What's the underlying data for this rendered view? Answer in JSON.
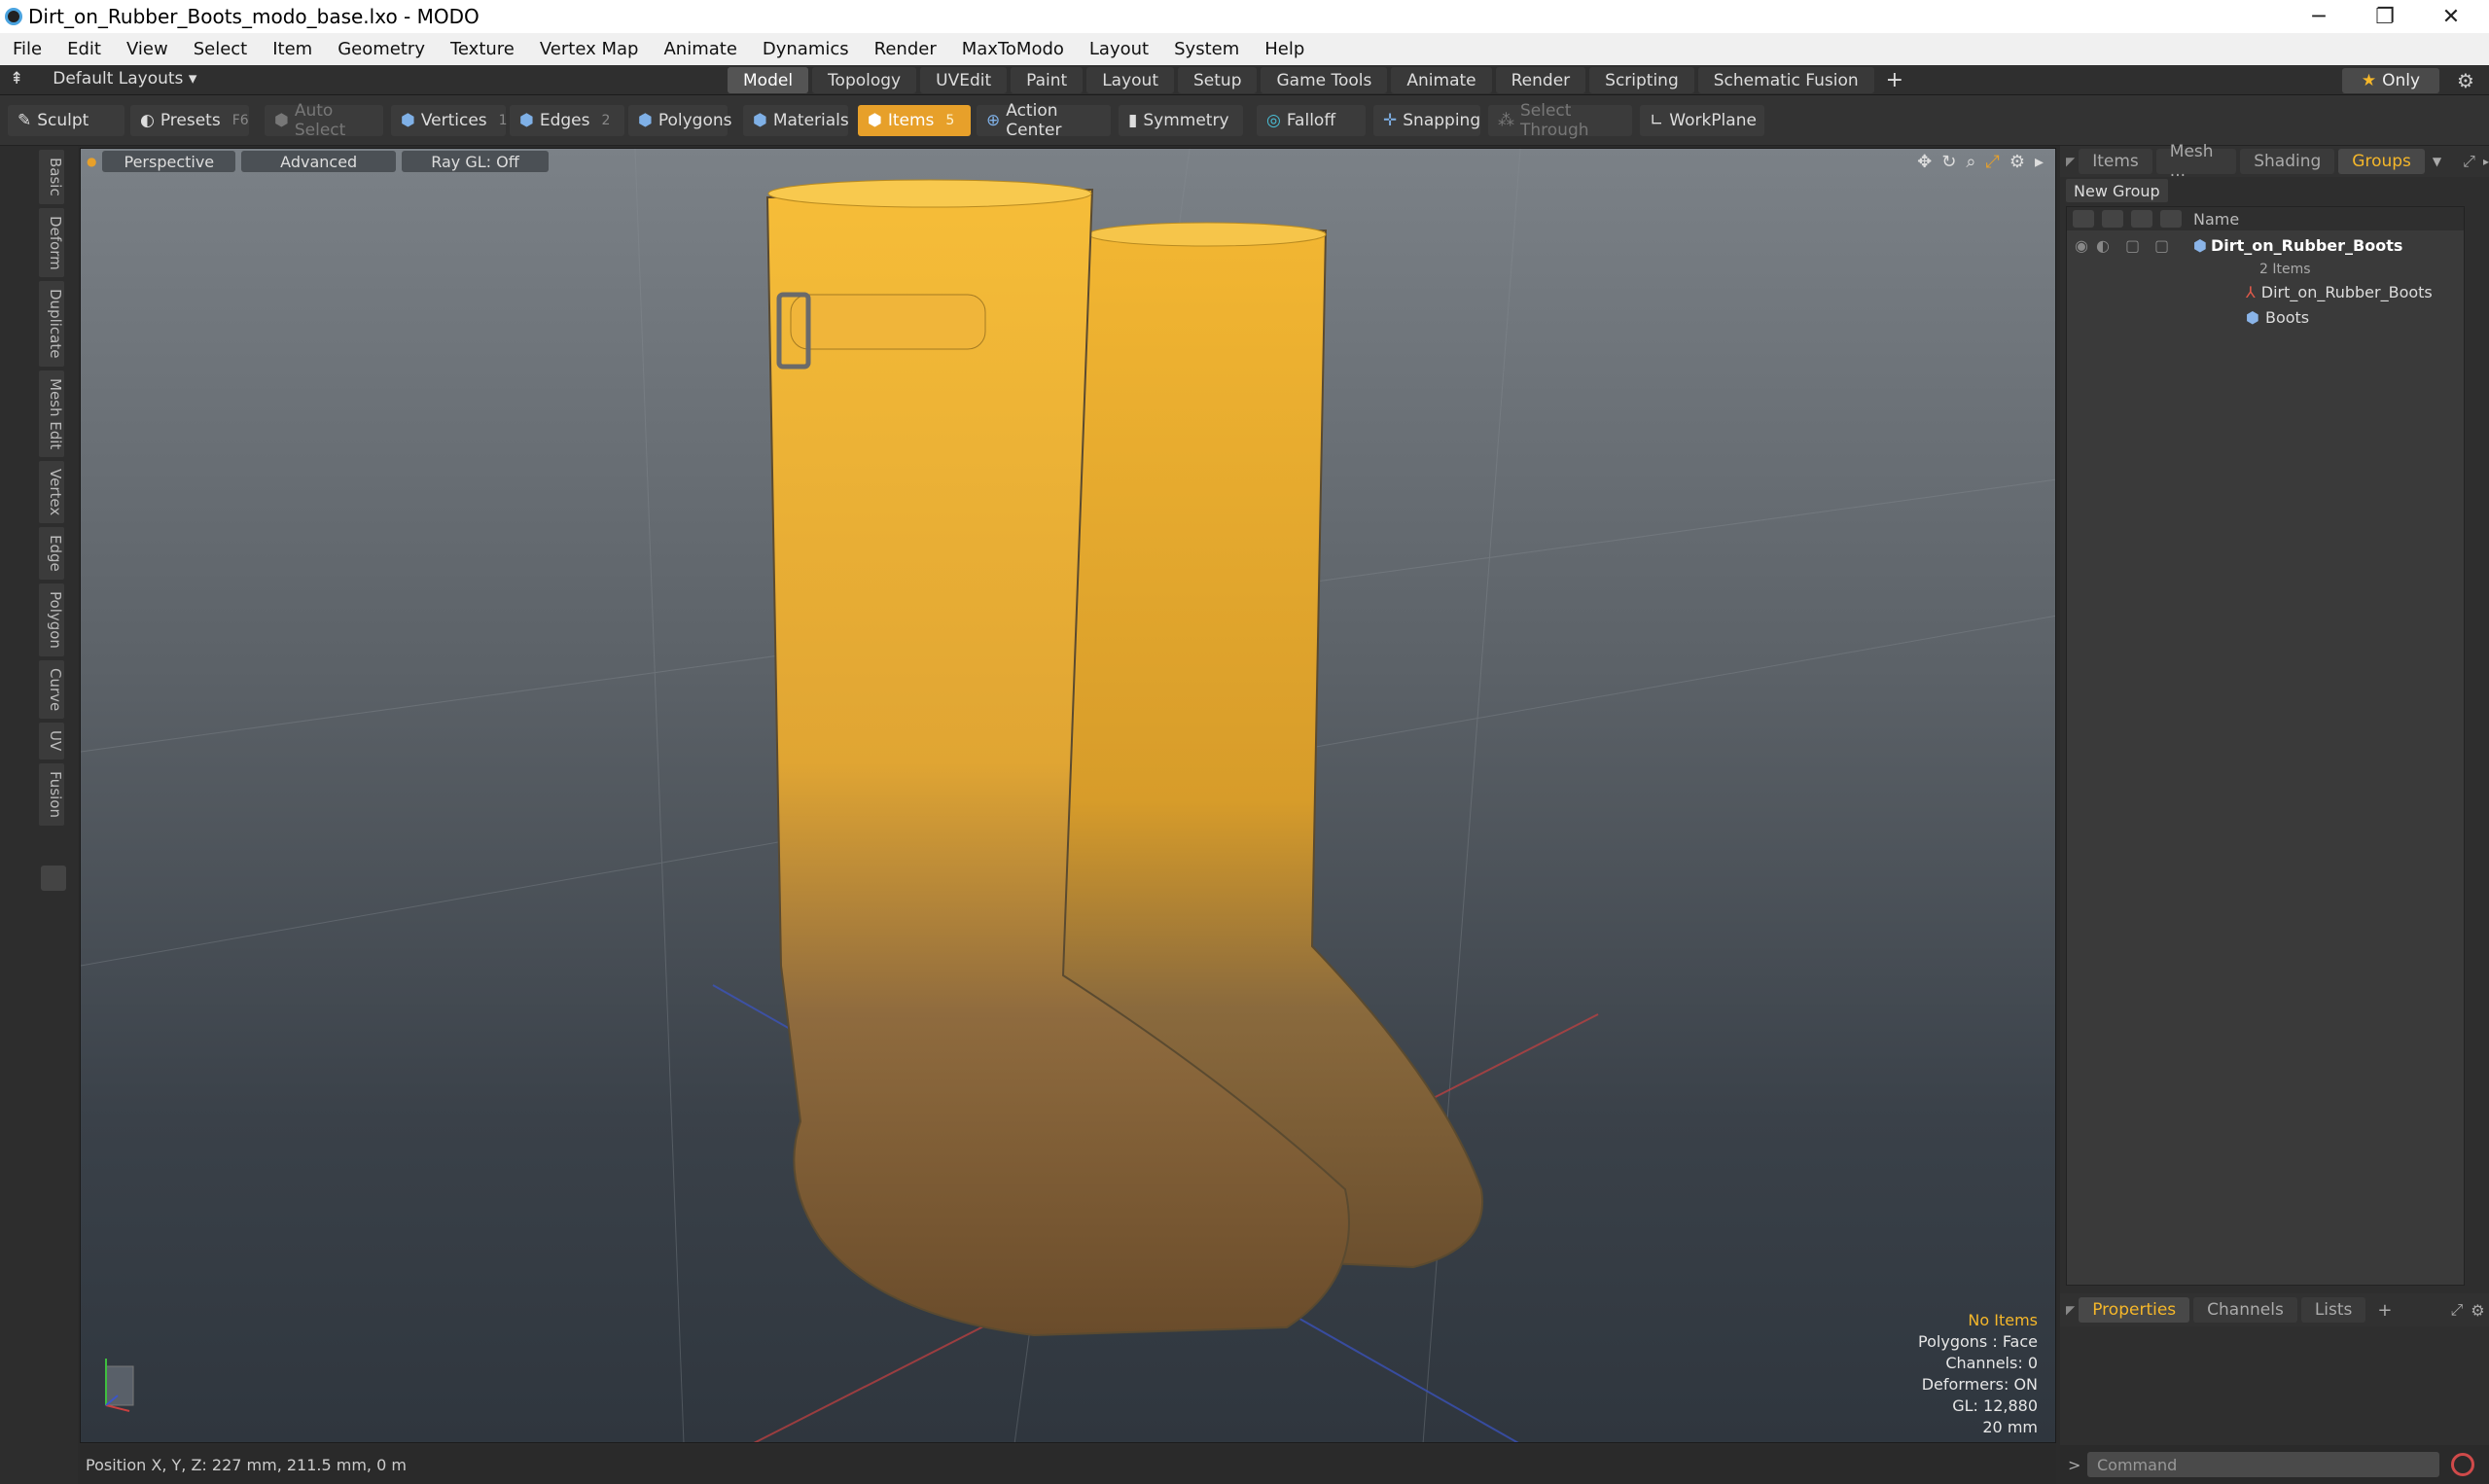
{
  "window": {
    "title": "Dirt_on_Rubber_Boots_modo_base.lxo - MODO",
    "minimize": "─",
    "maximize": "❐",
    "close": "✕"
  },
  "menu": [
    "File",
    "Edit",
    "View",
    "Select",
    "Item",
    "Geometry",
    "Texture",
    "Vertex Map",
    "Animate",
    "Dynamics",
    "Render",
    "MaxToModo",
    "Layout",
    "System",
    "Help"
  ],
  "layoutbar": {
    "layouts": "Default Layouts ▾",
    "tabs": [
      "Model",
      "Topology",
      "UVEdit",
      "Paint",
      "Layout",
      "Setup",
      "Game Tools",
      "Animate",
      "Render",
      "Scripting",
      "Schematic Fusion"
    ],
    "active": "Model",
    "plus": "+",
    "only": "Only"
  },
  "toolbar": {
    "sculpt": "Sculpt",
    "presets": "Presets",
    "presets_key": "F6",
    "auto_select": "Auto Select",
    "vertices": "Vertices",
    "vertices_num": "1",
    "edges": "Edges",
    "edges_num": "2",
    "polygons": "Polygons",
    "materials": "Materials",
    "items": "Items",
    "items_num": "5",
    "action_center": "Action Center",
    "symmetry": "Symmetry",
    "falloff": "Falloff",
    "snapping": "Snapping",
    "select_through": "Select Through",
    "workplane": "WorkPlane"
  },
  "lefttabs": [
    "Basic",
    "Deform",
    "Duplicate",
    "Mesh Edit",
    "Vertex",
    "Edge",
    "Polygon",
    "Curve",
    "UV",
    "Fusion"
  ],
  "viewport": {
    "perspective": "Perspective",
    "advanced": "Advanced",
    "raygl": "Ray GL: Off",
    "hud": {
      "no_items": "No Items",
      "polygons": "Polygons : Face",
      "channels": "Channels: 0",
      "deformers": "Deformers: ON",
      "gl": "GL: 12,880",
      "scale": "20 mm"
    }
  },
  "status": {
    "position": "Position X, Y, Z:  227 mm, 211.5 mm, 0 m"
  },
  "rightpanel": {
    "tabs": [
      "Items",
      "Mesh ...",
      "Shading",
      "Groups"
    ],
    "active": "Groups",
    "new_group": "New Group",
    "name_col": "Name",
    "tree": {
      "group": "Dirt_on_Rubber_Boots",
      "group_sub": "2 Items",
      "item1": "Dirt_on_Rubber_Boots",
      "item2": "Boots"
    },
    "props_tabs": [
      "Properties",
      "Channels",
      "Lists"
    ],
    "props_plus": "+",
    "command": "Command"
  },
  "colors": {
    "accent": "#f5b72a",
    "active_tool": "#e7a02a",
    "boot_yellow": "#f2b632",
    "mud": "#7a5a33"
  }
}
